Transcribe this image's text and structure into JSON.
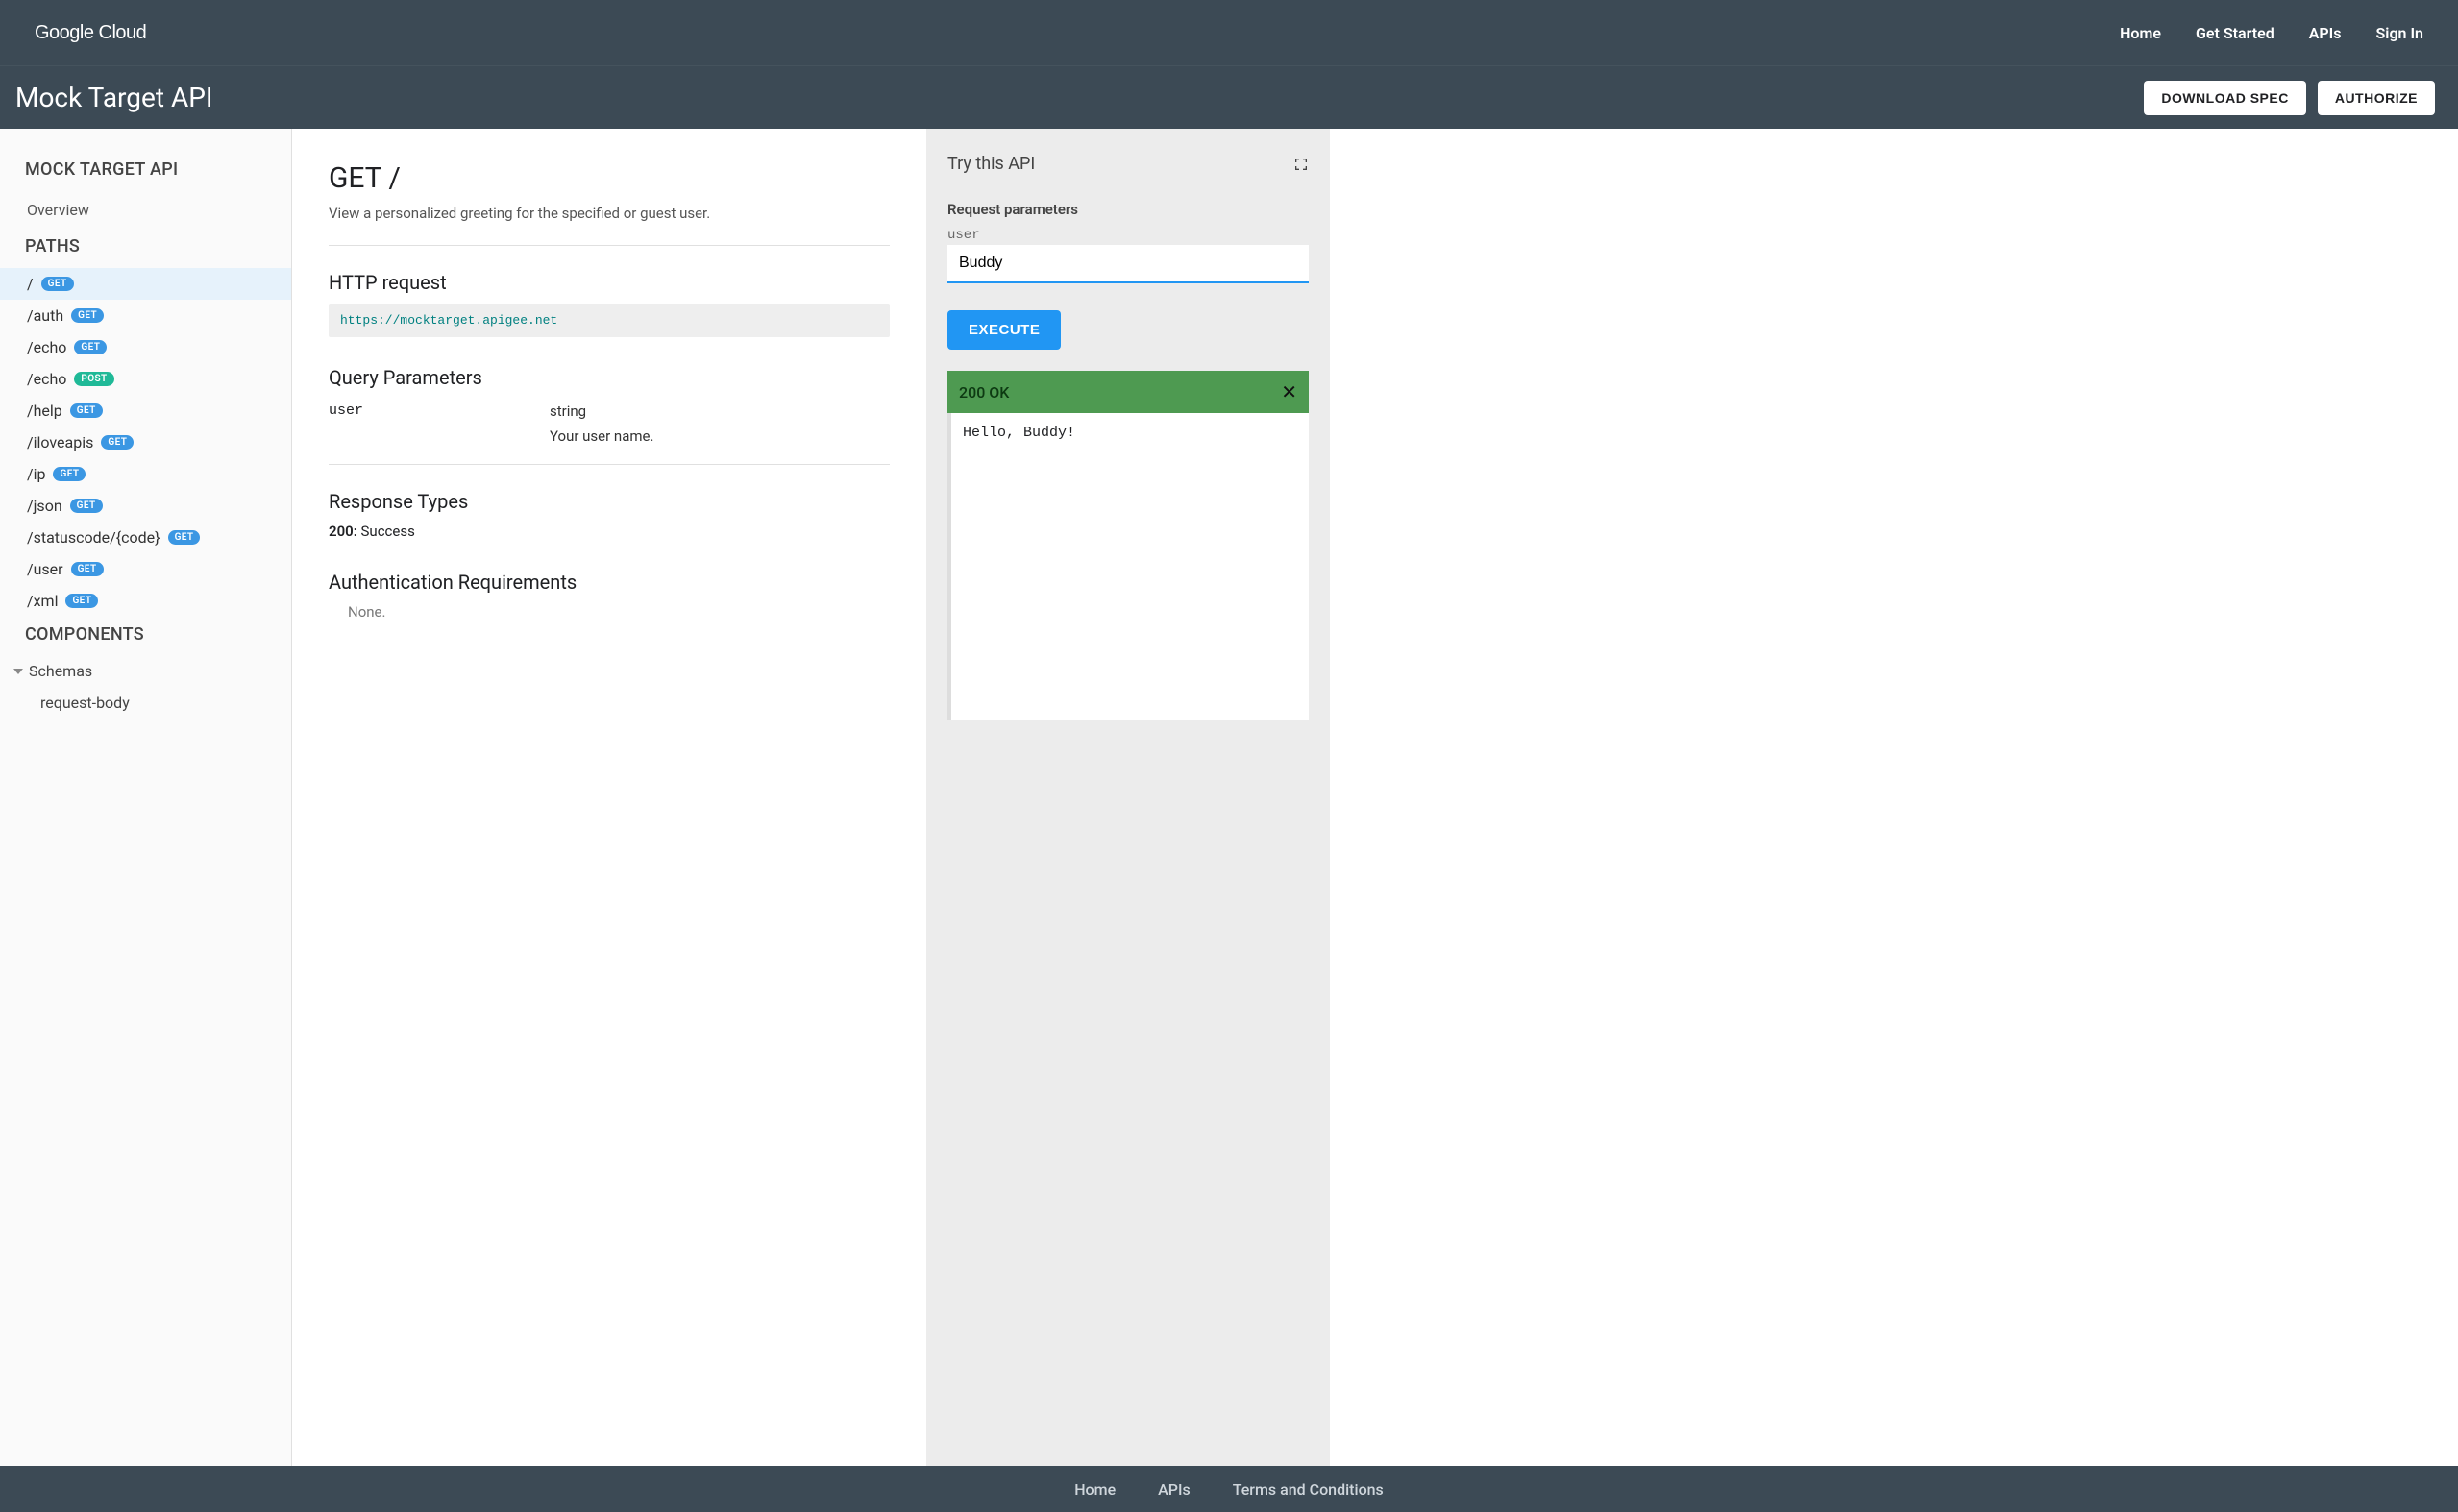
{
  "header": {
    "logo": "Google Cloud",
    "nav": {
      "home": "Home",
      "get_started": "Get Started",
      "apis": "APIs",
      "sign_in": "Sign In"
    }
  },
  "subbar": {
    "title": "Mock Target API",
    "download_spec": "DOWNLOAD SPEC",
    "authorize": "AUTHORIZE"
  },
  "sidebar": {
    "api_title": "MOCK TARGET API",
    "overview": "Overview",
    "paths_title": "PATHS",
    "paths": [
      {
        "path": "/",
        "method": "GET",
        "active": true
      },
      {
        "path": "/auth",
        "method": "GET"
      },
      {
        "path": "/echo",
        "method": "GET"
      },
      {
        "path": "/echo",
        "method": "POST"
      },
      {
        "path": "/help",
        "method": "GET"
      },
      {
        "path": "/iloveapis",
        "method": "GET"
      },
      {
        "path": "/ip",
        "method": "GET"
      },
      {
        "path": "/json",
        "method": "GET"
      },
      {
        "path": "/statuscode/{code}",
        "method": "GET"
      },
      {
        "path": "/user",
        "method": "GET"
      },
      {
        "path": "/xml",
        "method": "GET"
      }
    ],
    "components_title": "COMPONENTS",
    "schemas_label": "Schemas",
    "schema_items": [
      "request-body"
    ]
  },
  "main": {
    "title": "GET /",
    "description": "View a personalized greeting for the specified or guest user.",
    "http_request_heading": "HTTP request",
    "http_request_url": "https://mocktarget.apigee.net",
    "query_params_heading": "Query Parameters",
    "query_params": [
      {
        "name": "user",
        "type": "string",
        "desc": "Your user name."
      }
    ],
    "response_types_heading": "Response Types",
    "response_code": "200:",
    "response_text": " Success",
    "auth_heading": "Authentication Requirements",
    "auth_text": "None."
  },
  "try_panel": {
    "title": "Try this API",
    "req_params_heading": "Request parameters",
    "param_label": "user",
    "param_value": "Buddy",
    "execute_label": "EXECUTE",
    "status_text": "200 OK",
    "response_body": "Hello, Buddy!"
  },
  "footer": {
    "home": "Home",
    "apis": "APIs",
    "terms": "Terms and Conditions"
  }
}
